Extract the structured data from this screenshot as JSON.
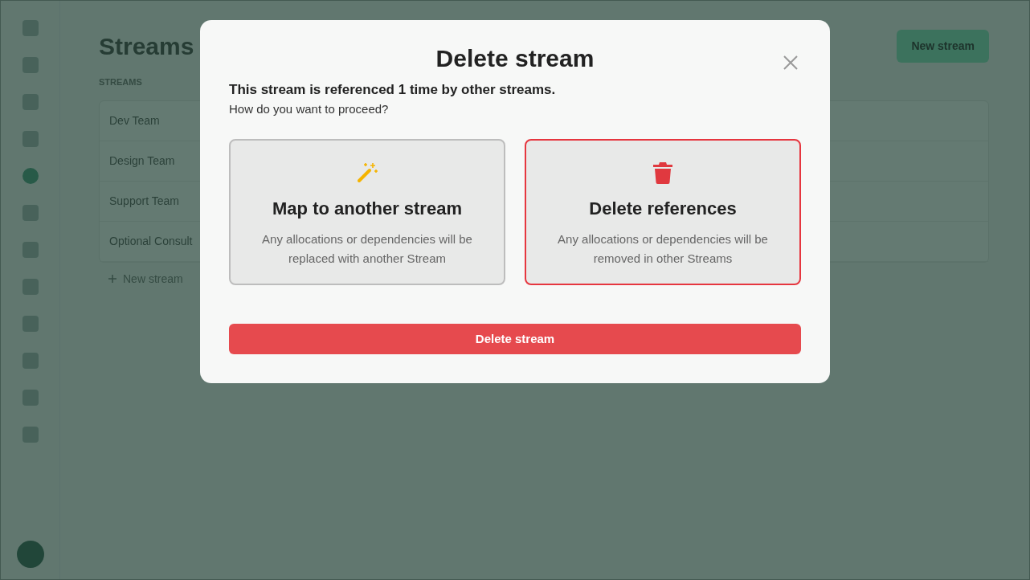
{
  "page": {
    "title": "Streams",
    "new_button": "New stream",
    "table_header": "STREAMS",
    "rows": [
      {
        "name": "Dev Team"
      },
      {
        "name": "Design Team"
      },
      {
        "name": "Support Team"
      },
      {
        "name": "Optional Consult"
      }
    ],
    "add_link": "New stream"
  },
  "dialog": {
    "title": "Delete stream",
    "message": "This stream is referenced 1 time by other streams.",
    "question": "How do you want to proceed?",
    "options": [
      {
        "kind": "wand",
        "title": "Map to another stream",
        "description": "Any allocations or dependencies will be replaced with another Stream",
        "selected": false
      },
      {
        "kind": "trash",
        "title": "Delete references",
        "description": "Any allocations or dependencies will be removed in other Streams",
        "selected": true
      }
    ],
    "confirm_button": "Delete stream"
  }
}
